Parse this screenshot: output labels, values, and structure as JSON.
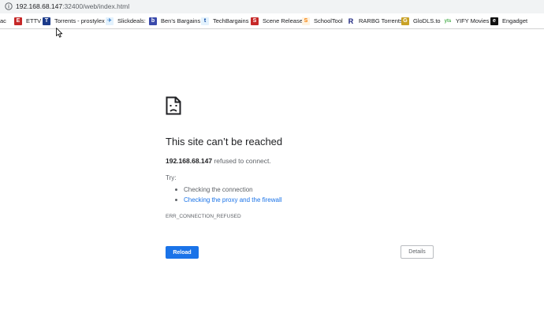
{
  "address_bar": {
    "host": "192.168.68.147",
    "path": ":32400/web/index.html",
    "icon": "info-icon"
  },
  "bookmarks": [
    {
      "label": "ac",
      "icon": ""
    },
    {
      "label": "ETTV",
      "icon": "ettv-icon",
      "glyph": "E",
      "color": "#c62828"
    },
    {
      "label": "Torrents - prostylex",
      "icon": "torrents-icon",
      "glyph": "T",
      "color": "#1b3a8a"
    },
    {
      "label": "Slickdeals:",
      "icon": "slickdeals-icon",
      "glyph": "✈",
      "color": "#1565c0"
    },
    {
      "label": "Ben's Bargains",
      "icon": "bens-bargains-icon",
      "glyph": "b",
      "color": "#3949ab"
    },
    {
      "label": "TechBargains",
      "icon": "techbargains-icon",
      "glyph": "t",
      "color": "#0d47a1"
    },
    {
      "label": "Scene Release",
      "icon": "scene-release-icon",
      "glyph": "S",
      "color": "#c62828"
    },
    {
      "label": "SchoolTool",
      "icon": "schooltool-icon",
      "glyph": "S",
      "color": "#f57c00"
    },
    {
      "label": "RARBG Torrents",
      "icon": "rarbg-icon",
      "glyph": "R",
      "color": "#1a237e"
    },
    {
      "label": "GloDLS.to",
      "icon": "glodls-icon",
      "glyph": "G",
      "color": "#c9a227"
    },
    {
      "label": "YIFY Movies",
      "icon": "yify-icon",
      "glyph": "yts",
      "color": "#4caf50"
    },
    {
      "label": "Engadget",
      "icon": "engadget-icon",
      "glyph": "e",
      "color": "#111111"
    }
  ],
  "error": {
    "title": "This site can’t be reached",
    "host": "192.168.68.147",
    "message": " refused to connect.",
    "try_label": "Try:",
    "suggestions": [
      "Checking the connection",
      "Checking the proxy and the firewall"
    ],
    "code": "ERR_CONNECTION_REFUSED",
    "reload_label": "Reload",
    "details_label": "Details",
    "accent_color": "#1a73e8"
  }
}
